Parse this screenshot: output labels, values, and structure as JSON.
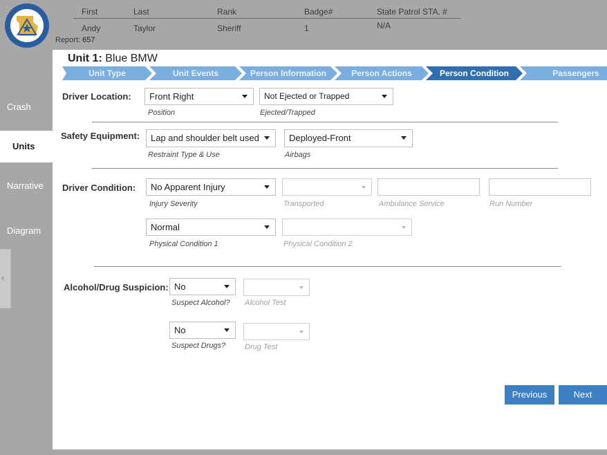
{
  "header": {
    "columns": [
      {
        "heading": "First",
        "value": "Andy"
      },
      {
        "heading": "Last",
        "value": "Taylor"
      },
      {
        "heading": "Rank",
        "value": "Sheriff"
      },
      {
        "heading": "Badge#",
        "value": "1"
      },
      {
        "heading": "State Patrol STA. #",
        "value": "N/A"
      }
    ],
    "report_label": "Report:",
    "report_number": "657"
  },
  "sidebar": {
    "items": [
      {
        "label": "Crash",
        "active": false
      },
      {
        "label": "Units",
        "active": true
      },
      {
        "label": "Narrative",
        "active": false
      },
      {
        "label": "Diagram",
        "active": false
      }
    ],
    "collapse_glyph": "‹"
  },
  "unit": {
    "label": "Unit 1:",
    "name": "Blue BMW"
  },
  "steps": [
    {
      "label": "Unit Type",
      "active": false
    },
    {
      "label": "Unit Events",
      "active": false
    },
    {
      "label": "Person Information",
      "active": false
    },
    {
      "label": "Person Actions",
      "active": false
    },
    {
      "label": "Person Condition",
      "active": true
    },
    {
      "label": "Passengers",
      "active": false
    }
  ],
  "driver_location": {
    "label": "Driver Location:",
    "position": {
      "value": "Front Right",
      "caption": "Position"
    },
    "ejected": {
      "value": "Not Ejected or Trapped",
      "caption": "Ejected/Trapped"
    }
  },
  "safety_equipment": {
    "label": "Safety Equipment:",
    "restraint": {
      "value": "Lap and shoulder belt used",
      "caption": "Restraint Type & Use"
    },
    "airbags": {
      "value": "Deployed-Front",
      "caption": "Airbags"
    }
  },
  "driver_condition": {
    "label": "Driver Condition:",
    "injury": {
      "value": "No Apparent Injury",
      "caption": "Injury Severity"
    },
    "transported": {
      "value": "",
      "caption": "Transported"
    },
    "ambulance": {
      "value": "",
      "caption": "Ambulance Service"
    },
    "run_number": {
      "value": "",
      "caption": "Run Number"
    },
    "physical1": {
      "value": "Normal",
      "caption": "Physical Condition 1"
    },
    "physical2": {
      "value": "",
      "caption": "Physical Condition 2"
    }
  },
  "suspicion": {
    "label": "Alcohol/Drug Suspicion:",
    "alcohol": {
      "value": "No",
      "caption": "Suspect Alcohol?"
    },
    "alcohol_test": {
      "value": "",
      "caption": "Alcohol Test"
    },
    "drugs": {
      "value": "No",
      "caption": "Suspect Drugs?"
    },
    "drug_test": {
      "value": "",
      "caption": "Drug Test"
    }
  },
  "buttons": {
    "previous": "Previous",
    "next": "Next"
  },
  "colors": {
    "accent": "#3c7fc2",
    "step_active": "#2f6fb0",
    "step_inactive": "#7aaede",
    "chrome": "#a7a7a7"
  }
}
